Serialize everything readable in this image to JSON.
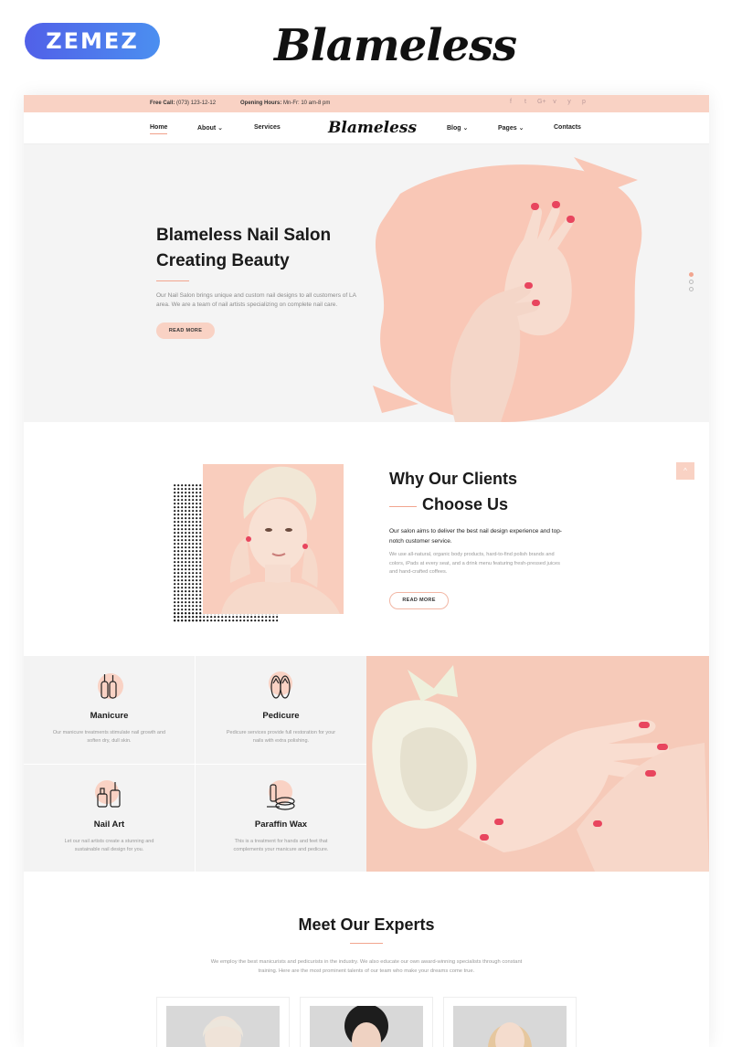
{
  "promo": {
    "brand": "ZEMEZ",
    "title": "Blameless"
  },
  "topbar": {
    "free_call_label": "Free Call:",
    "free_call_value": "(073) 123-12-12",
    "hours_label": "Opening Hours:",
    "hours_value": "Mn-Fr: 10 am-8 pm",
    "socials": [
      "f",
      "t",
      "G+",
      "v",
      "y",
      "p"
    ],
    "social_icons": [
      "facebook-icon",
      "twitter-icon",
      "google-plus-icon",
      "vimeo-icon",
      "youtube-icon",
      "pinterest-icon"
    ]
  },
  "nav": {
    "logo": "Blameless",
    "items": [
      {
        "label": "Home",
        "active": true
      },
      {
        "label": "About ⌄"
      },
      {
        "label": "Services"
      },
      {
        "label": "Blog ⌄"
      },
      {
        "label": "Pages ⌄"
      },
      {
        "label": "Contacts"
      }
    ]
  },
  "hero": {
    "title_line1": "Blameless Nail Salon",
    "title_line2": "Creating Beauty",
    "text": "Our Nail Salon brings unique and custom nail designs to all customers of LA area. We are a team of nail artists specializing on complete nail care.",
    "button": "READ MORE",
    "slides": 3,
    "active_slide": 1
  },
  "why": {
    "title_line1": "Why Our Clients",
    "title_line2": "Choose Us",
    "lead": "Our salon aims to deliver the best nail design experience and top-notch customer service.",
    "text": "We use all-natural, organic body products, hard-to-find polish brands and colors, iPads at every seat, and a drink menu featuring fresh-pressed juices and hand-crafted coffees.",
    "button": "READ MORE",
    "scroll_top": "^"
  },
  "services": [
    {
      "title": "Manicure",
      "desc": "Our manicure treatments stimulate nail growth and soften dry, dull skin.",
      "icon": "nail-polish-icon"
    },
    {
      "title": "Pedicure",
      "desc": "Pedicure services provide full restoration for your nails with extra polishing.",
      "icon": "flip-flops-icon"
    },
    {
      "title": "Nail Art",
      "desc": "Let our nail artists create a stunning and sustainable nail design for you.",
      "icon": "polish-bottle-icon"
    },
    {
      "title": "Paraffin Wax",
      "desc": "This is a treatment for hands and feet that complements your manicure and pedicure.",
      "icon": "cream-jar-icon"
    }
  ],
  "experts": {
    "title": "Meet Our Experts",
    "text": "We employ the best manicurists and pedicurists in the industry. We also educate our own award-winning specialists through constant training. Here are the most prominent talents of our team who make your dreams come true."
  },
  "colors": {
    "accent": "#f9d2c4",
    "accent_dark": "#f2a58f",
    "nail": "#e8455e"
  }
}
